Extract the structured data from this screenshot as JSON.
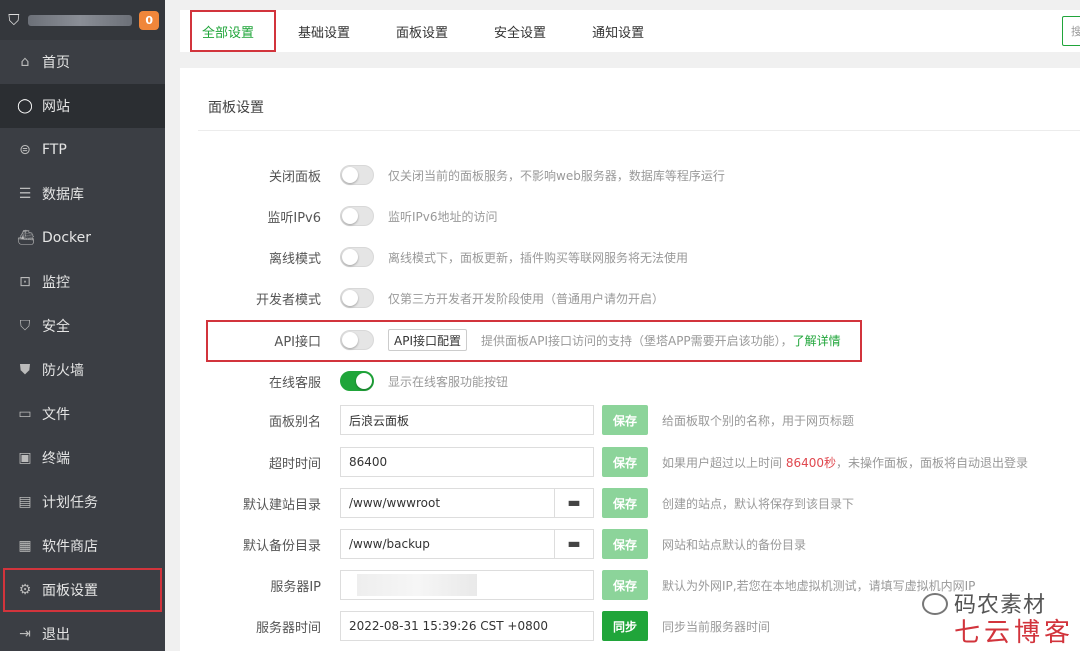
{
  "sidebar": {
    "badge": "0",
    "items": [
      {
        "label": "首页",
        "icon": "home-icon",
        "glyph": "⌂"
      },
      {
        "label": "网站",
        "icon": "globe-icon",
        "glyph": "◯"
      },
      {
        "label": "FTP",
        "icon": "ftp-icon",
        "glyph": "⊜"
      },
      {
        "label": "数据库",
        "icon": "database-icon",
        "glyph": "☰"
      },
      {
        "label": "Docker",
        "icon": "docker-icon",
        "glyph": "⛴"
      },
      {
        "label": "监控",
        "icon": "monitor-icon",
        "glyph": "⊡"
      },
      {
        "label": "安全",
        "icon": "shield-check-icon",
        "glyph": "⛉"
      },
      {
        "label": "防火墙",
        "icon": "firewall-icon",
        "glyph": "⛊"
      },
      {
        "label": "文件",
        "icon": "folder-icon",
        "glyph": "▭"
      },
      {
        "label": "终端",
        "icon": "terminal-icon",
        "glyph": "▣"
      },
      {
        "label": "计划任务",
        "icon": "calendar-icon",
        "glyph": "▤"
      },
      {
        "label": "软件商店",
        "icon": "app-store-icon",
        "glyph": "▦"
      },
      {
        "label": "面板设置",
        "icon": "gear-icon",
        "glyph": "⚙"
      },
      {
        "label": "退出",
        "icon": "logout-icon",
        "glyph": "⇥"
      }
    ]
  },
  "tabs": [
    {
      "label": "全部设置"
    },
    {
      "label": "基础设置"
    },
    {
      "label": "面板设置"
    },
    {
      "label": "安全设置"
    },
    {
      "label": "通知设置"
    }
  ],
  "search_hint": "搜",
  "panel": {
    "title": "面板设置",
    "toggles": [
      {
        "label": "关闭面板",
        "desc": "仅关闭当前的面板服务，不影响web服务器，数据库等程序运行",
        "on": false
      },
      {
        "label": "监听IPv6",
        "desc": "监听IPv6地址的访问",
        "on": false
      },
      {
        "label": "离线模式",
        "desc": "离线模式下，面板更新，插件购买等联网服务将无法使用",
        "on": false
      },
      {
        "label": "开发者模式",
        "desc": "仅第三方开发者开发阶段使用（普通用户请勿开启）",
        "on": false
      }
    ],
    "api": {
      "label": "API接口",
      "button": "API接口配置",
      "desc": "提供面板API接口访问的支持（堡塔APP需要开启该功能），",
      "link": "了解详情",
      "on": false
    },
    "service": {
      "label": "在线客服",
      "desc": "显示在线客服功能按钮",
      "on": true
    },
    "alias": {
      "label": "面板别名",
      "value": "后浪云面板",
      "save": "保存",
      "desc": "给面板取个别的名称，用于网页标题"
    },
    "timeout": {
      "label": "超时时间",
      "value": "86400",
      "save": "保存",
      "desc_a": "如果用户超过以上时间 ",
      "desc_red": "86400秒",
      "desc_b": "，未操作面板，面板将自动退出登录"
    },
    "site_dir": {
      "label": "默认建站目录",
      "value": "/www/wwwroot",
      "save": "保存",
      "desc": "创建的站点，默认将保存到该目录下"
    },
    "backup_dir": {
      "label": "默认备份目录",
      "value": "/www/backup",
      "save": "保存",
      "desc": "网站和站点默认的备份目录"
    },
    "server_ip": {
      "label": "服务器IP",
      "save": "保存",
      "desc": "默认为外网IP,若您在本地虚拟机测试，请填写虚拟机内网IP"
    },
    "server_time": {
      "label": "服务器时间",
      "value": "2022-08-31 15:39:26 CST +0800",
      "sync": "同步",
      "desc": "同步当前服务器时间"
    }
  },
  "watermark": {
    "primary": "码农素材",
    "secondary": "七云博客"
  }
}
